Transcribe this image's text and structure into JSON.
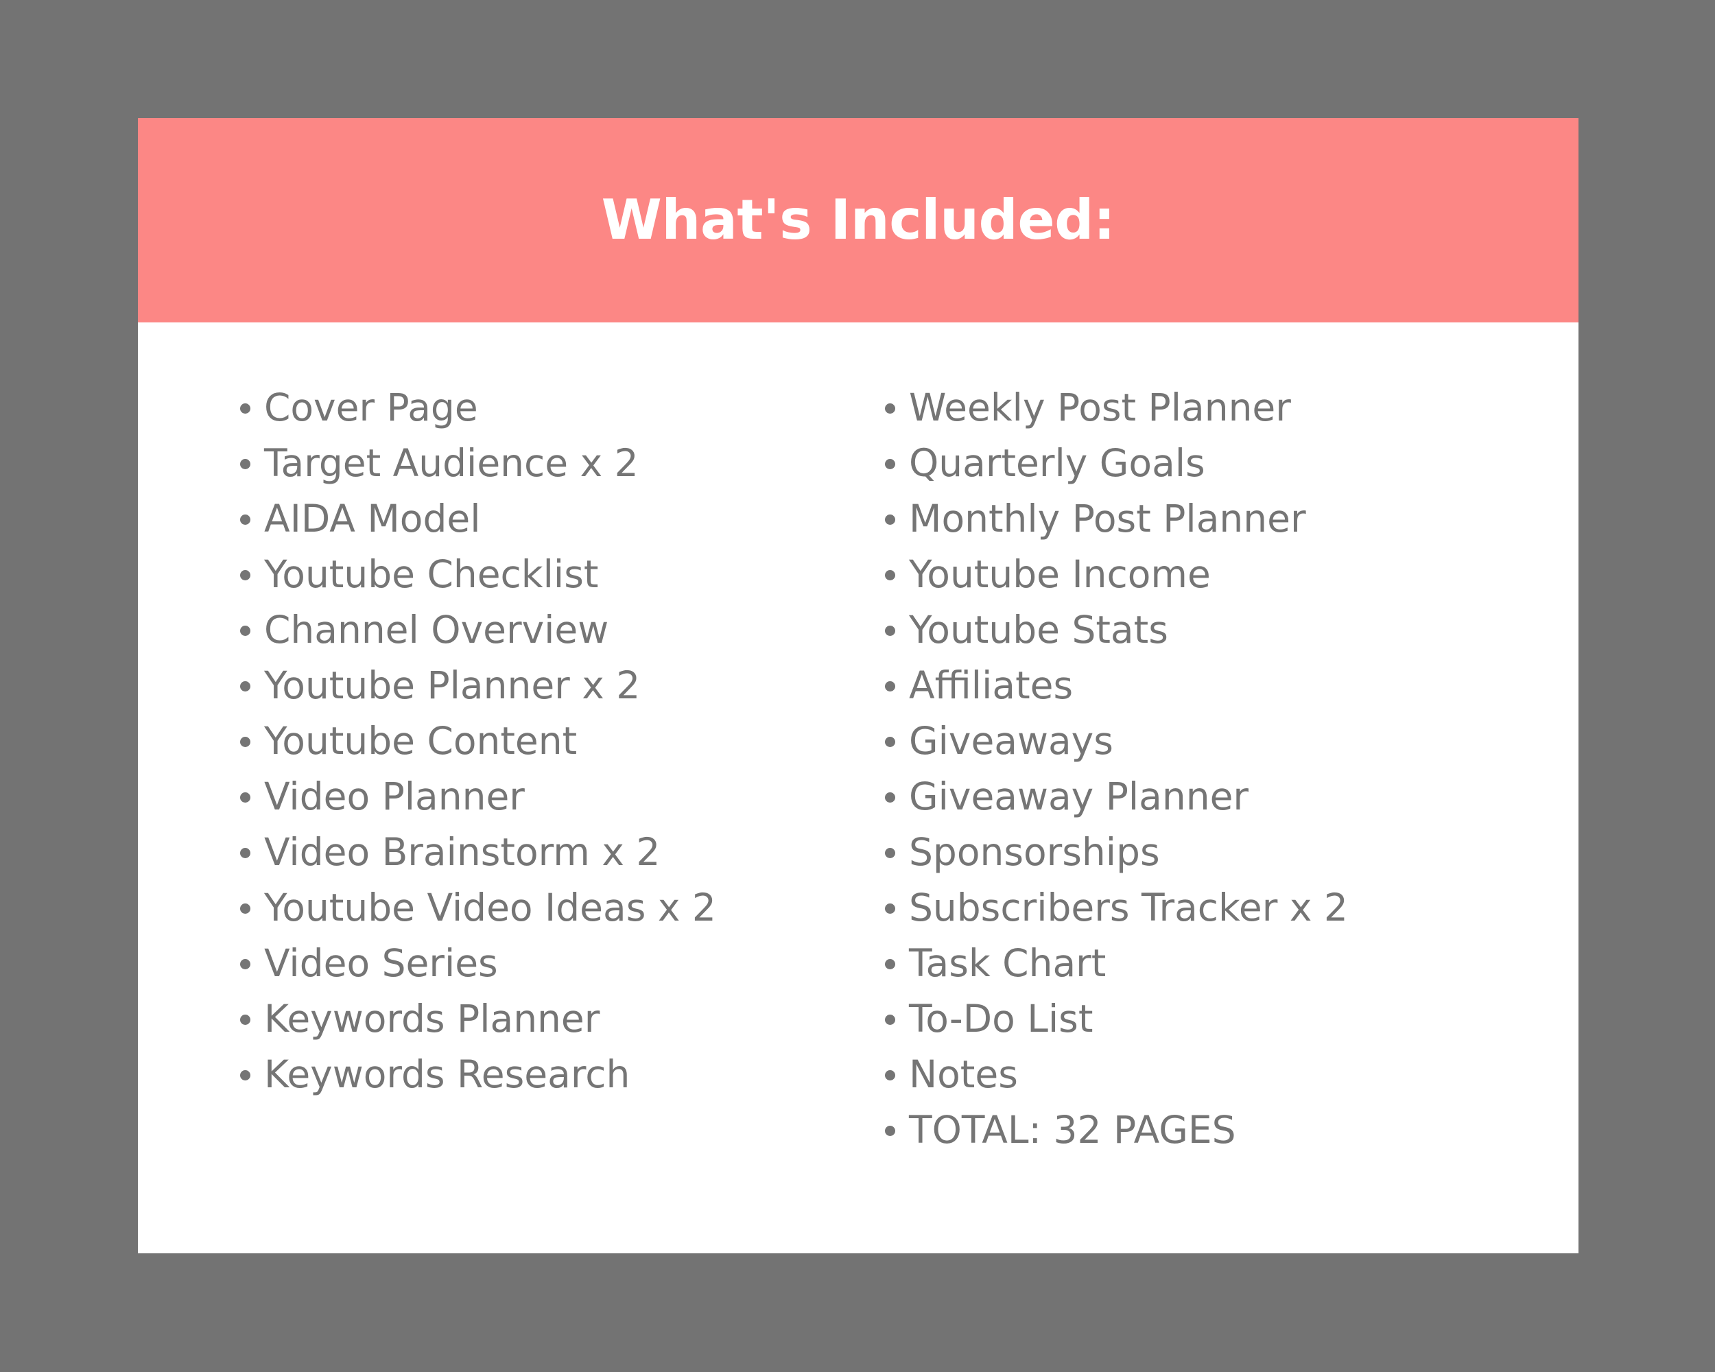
{
  "theme": {
    "page_background": "#737373",
    "card_background": "#FFFFFF",
    "header_band_color": "#FC8785",
    "header_text_color": "#FFFFFF",
    "list_text_color": "#757575",
    "bullet_color": "#757575"
  },
  "header": {
    "title": "What's Included:"
  },
  "content": {
    "left_column": [
      {
        "label": "Cover Page"
      },
      {
        "label": "Target Audience x 2"
      },
      {
        "label": "AIDA Model"
      },
      {
        "label": "Youtube Checklist"
      },
      {
        "label": "Channel Overview"
      },
      {
        "label": "Youtube Planner x 2"
      },
      {
        "label": "Youtube Content"
      },
      {
        "label": "Video Planner"
      },
      {
        "label": "Video Brainstorm x 2"
      },
      {
        "label": "Youtube Video Ideas x 2"
      },
      {
        "label": "Video Series"
      },
      {
        "label": "Keywords Planner"
      },
      {
        "label": "Keywords Research"
      }
    ],
    "right_column": [
      {
        "label": "Weekly Post Planner"
      },
      {
        "label": "Quarterly Goals"
      },
      {
        "label": "Monthly Post Planner"
      },
      {
        "label": "Youtube Income"
      },
      {
        "label": "Youtube Stats"
      },
      {
        "label": "Affiliates"
      },
      {
        "label": "Giveaways"
      },
      {
        "label": "Giveaway Planner"
      },
      {
        "label": "Sponsorships"
      },
      {
        "label": "Subscribers Tracker x 2"
      },
      {
        "label": "Task Chart"
      },
      {
        "label": "To-Do List"
      },
      {
        "label": "Notes"
      },
      {
        "label": "TOTAL: 32 PAGES"
      }
    ]
  }
}
